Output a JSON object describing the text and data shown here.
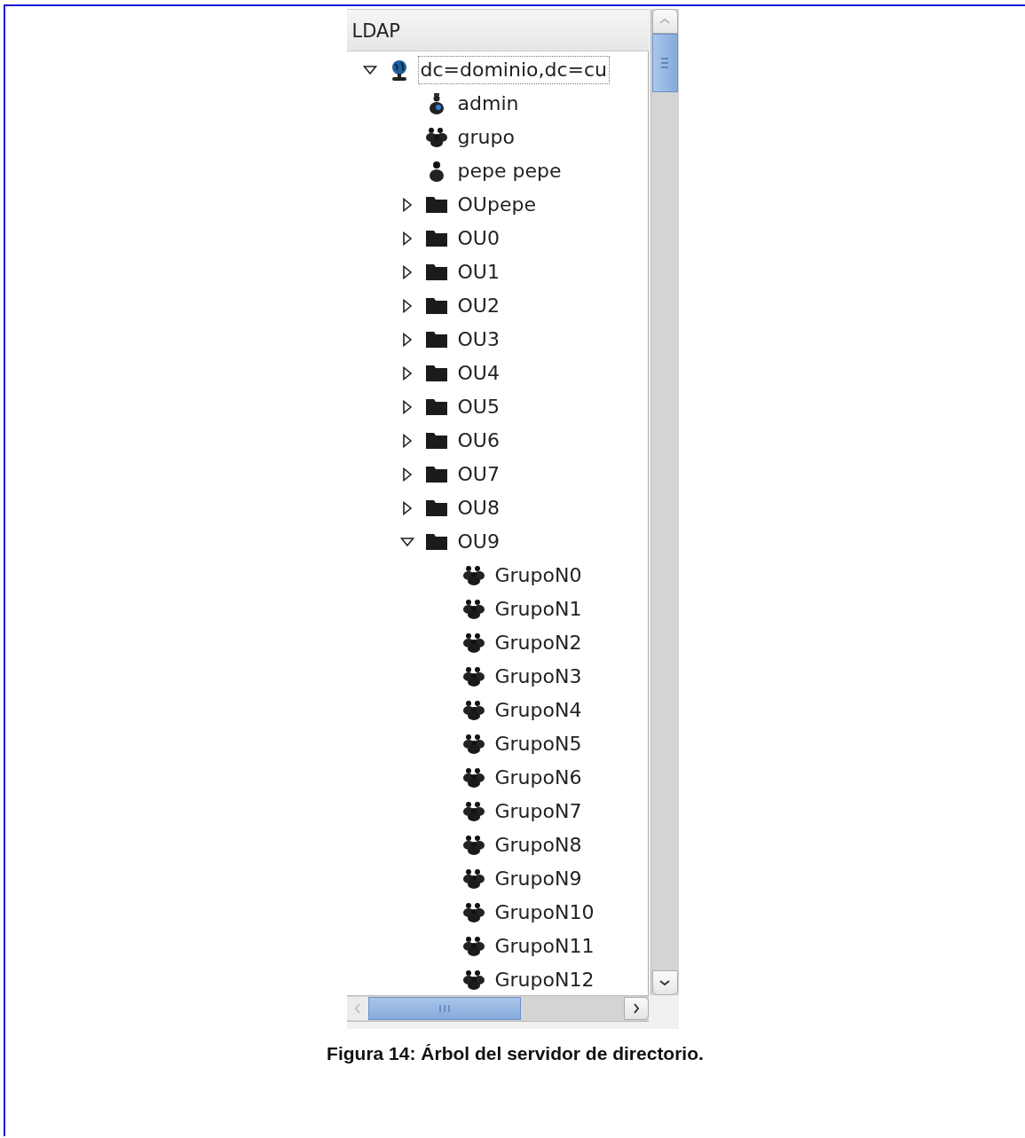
{
  "panel": {
    "header": "LDAP",
    "tree": [
      {
        "kind": "domain",
        "label": "dc=dominio,dc=cu",
        "expanded": true,
        "selected": true,
        "children": [
          {
            "kind": "admin",
            "label": "admin",
            "selected": false
          },
          {
            "kind": "group",
            "label": "grupo",
            "selected": false
          },
          {
            "kind": "user",
            "label": "pepe pepe",
            "selected": false
          },
          {
            "kind": "ou",
            "label": "OUpepe",
            "expanded": false,
            "selected": false
          },
          {
            "kind": "ou",
            "label": "OU0",
            "expanded": false,
            "selected": false
          },
          {
            "kind": "ou",
            "label": "OU1",
            "expanded": false,
            "selected": false
          },
          {
            "kind": "ou",
            "label": "OU2",
            "expanded": false,
            "selected": false
          },
          {
            "kind": "ou",
            "label": "OU3",
            "expanded": false,
            "selected": false
          },
          {
            "kind": "ou",
            "label": "OU4",
            "expanded": false,
            "selected": false
          },
          {
            "kind": "ou",
            "label": "OU5",
            "expanded": false,
            "selected": false
          },
          {
            "kind": "ou",
            "label": "OU6",
            "expanded": false,
            "selected": false
          },
          {
            "kind": "ou",
            "label": "OU7",
            "expanded": false,
            "selected": false
          },
          {
            "kind": "ou",
            "label": "OU8",
            "expanded": false,
            "selected": false
          },
          {
            "kind": "ou",
            "label": "OU9",
            "expanded": true,
            "selected": false,
            "children": [
              {
                "kind": "group",
                "label": "GrupoN0",
                "selected": false
              },
              {
                "kind": "group",
                "label": "GrupoN1",
                "selected": false
              },
              {
                "kind": "group",
                "label": "GrupoN2",
                "selected": false
              },
              {
                "kind": "group",
                "label": "GrupoN3",
                "selected": false
              },
              {
                "kind": "group",
                "label": "GrupoN4",
                "selected": false
              },
              {
                "kind": "group",
                "label": "GrupoN5",
                "selected": false
              },
              {
                "kind": "group",
                "label": "GrupoN6",
                "selected": false
              },
              {
                "kind": "group",
                "label": "GrupoN7",
                "selected": false
              },
              {
                "kind": "group",
                "label": "GrupoN8",
                "selected": false
              },
              {
                "kind": "group",
                "label": "GrupoN9",
                "selected": false
              },
              {
                "kind": "group",
                "label": "GrupoN10",
                "selected": false
              },
              {
                "kind": "group",
                "label": "GrupoN11",
                "selected": false
              },
              {
                "kind": "group",
                "label": "GrupoN12",
                "selected": false
              }
            ]
          }
        ]
      }
    ]
  },
  "caption": "Figura 14: Árbol del servidor de directorio."
}
